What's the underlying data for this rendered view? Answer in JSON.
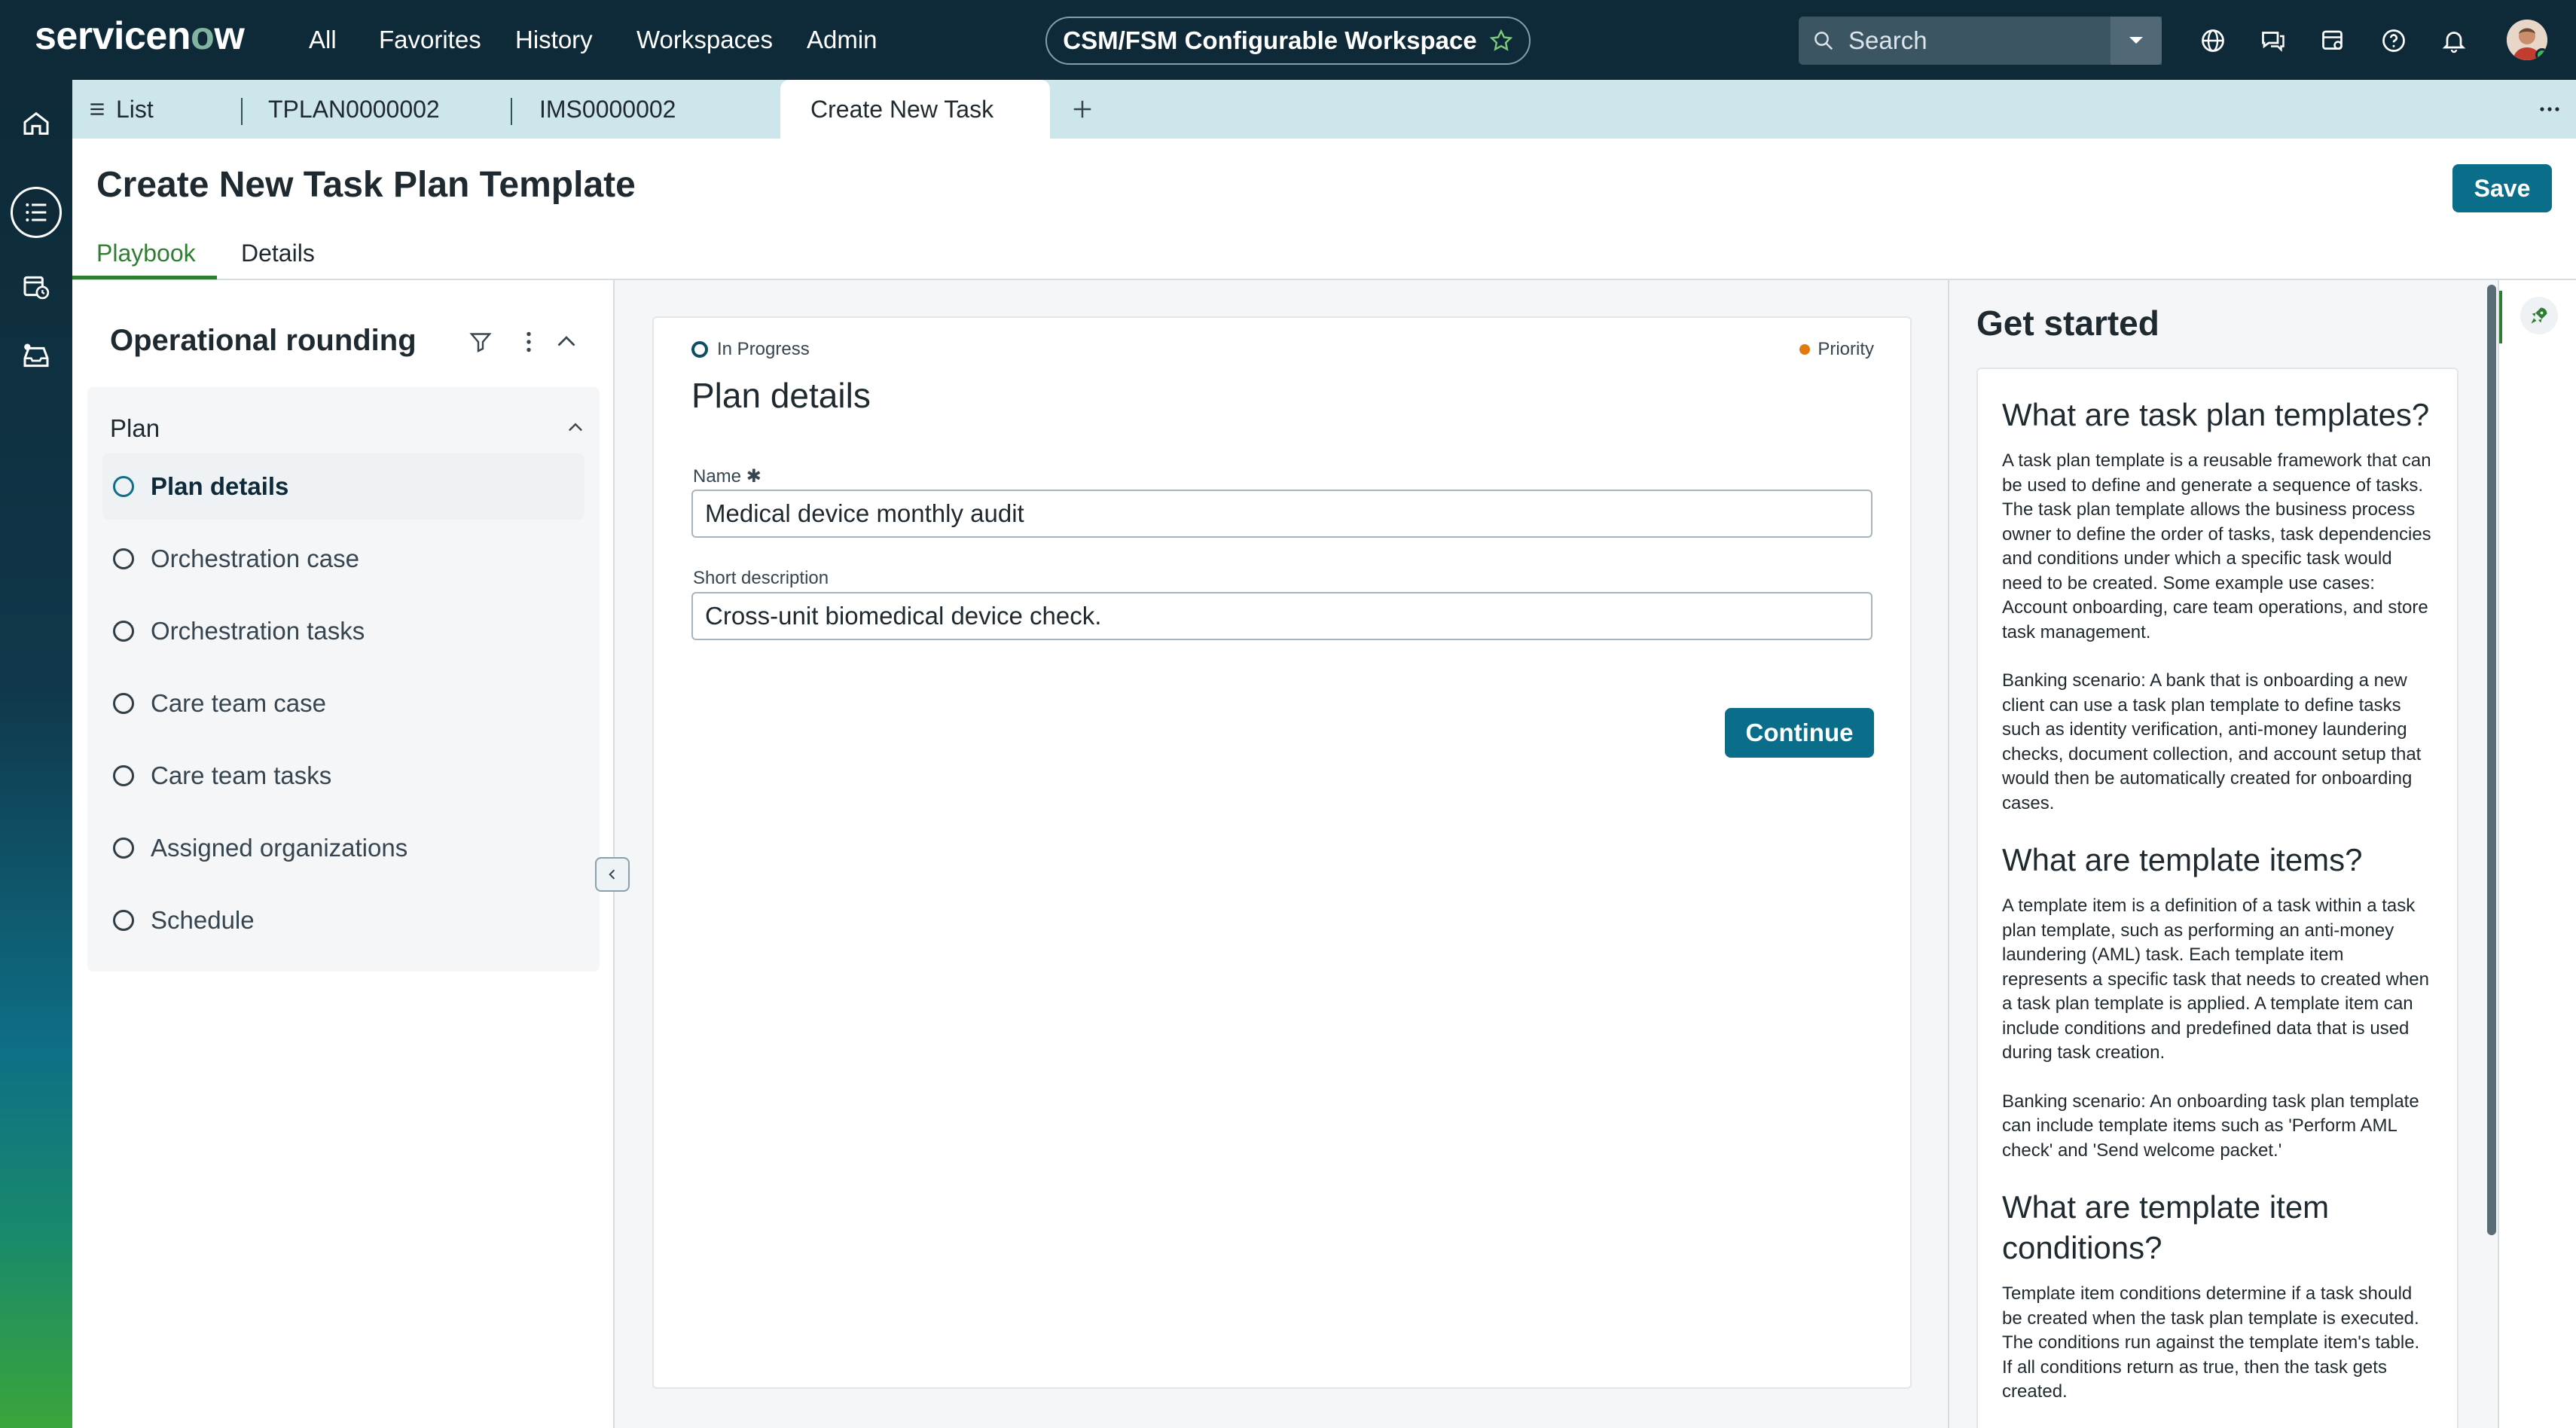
{
  "header": {
    "brand": "servicenow",
    "nav": [
      "All",
      "Favorites",
      "History",
      "Workspaces",
      "Admin"
    ],
    "workspace_name": "CSM/FSM Configurable Workspace",
    "search_placeholder": "Search"
  },
  "tabs": {
    "list_label": "List",
    "items": [
      "TPLAN0000002",
      "IMS0000002",
      "Create New Task"
    ],
    "active": "Create New Task"
  },
  "page": {
    "title": "Create New Task Plan Template",
    "save_label": "Save",
    "subtabs": [
      "Playbook",
      "Details"
    ],
    "active_subtab": "Playbook"
  },
  "playbook": {
    "title": "Operational rounding",
    "group_label": "Plan",
    "steps": [
      "Plan details",
      "Orchestration case",
      "Orchestration tasks",
      "Care team case",
      "Care team tasks",
      "Assigned organizations",
      "Schedule"
    ],
    "active_step": "Plan details"
  },
  "form": {
    "status": "In Progress",
    "priority_label": "Priority",
    "title": "Plan details",
    "name_label": "Name",
    "name_value": "Medical device monthly audit",
    "short_desc_label": "Short description",
    "short_desc_value": "Cross-unit biomedical device check.",
    "continue_label": "Continue"
  },
  "help": {
    "title": "Get started",
    "sections": [
      {
        "heading": "What are task plan templates?",
        "paragraphs": [
          "A task plan template is a reusable framework that can be used to define and generate a sequence of tasks. The task plan template allows the business process owner to define the order of tasks, task dependencies and conditions under which a specific task would need to be created. Some example use cases: Account onboarding, care team operations, and store task management.",
          "Banking scenario: A bank that is onboarding a new client can use a task plan template to define tasks such as identity verification, anti-money laundering checks, document collection, and account setup that would then be automatically created for onboarding cases."
        ]
      },
      {
        "heading": "What are template items?",
        "paragraphs": [
          "A template item is a definition of a task within a task plan template, such as performing an anti-money laundering (AML) task. Each template item represents a specific task that needs to created when a task plan template is applied. A template item can include conditions and predefined data that is used during task creation.",
          "Banking scenario: An onboarding task plan template can include template items such as 'Perform AML check' and 'Send welcome packet.'"
        ]
      },
      {
        "heading": "What are template item conditions?",
        "paragraphs": [
          "Template item conditions determine if a task should be created when the task plan template is executed. The conditions run against the template item's table. If all conditions return as true, then the task gets created."
        ]
      }
    ]
  },
  "colors": {
    "header_bg": "#0e2a38",
    "accent_button": "#0a6e8a",
    "active_tab_underline": "#2e7d32",
    "priority_dot": "#e07b10",
    "tabstrip_bg": "#cde6ec"
  }
}
